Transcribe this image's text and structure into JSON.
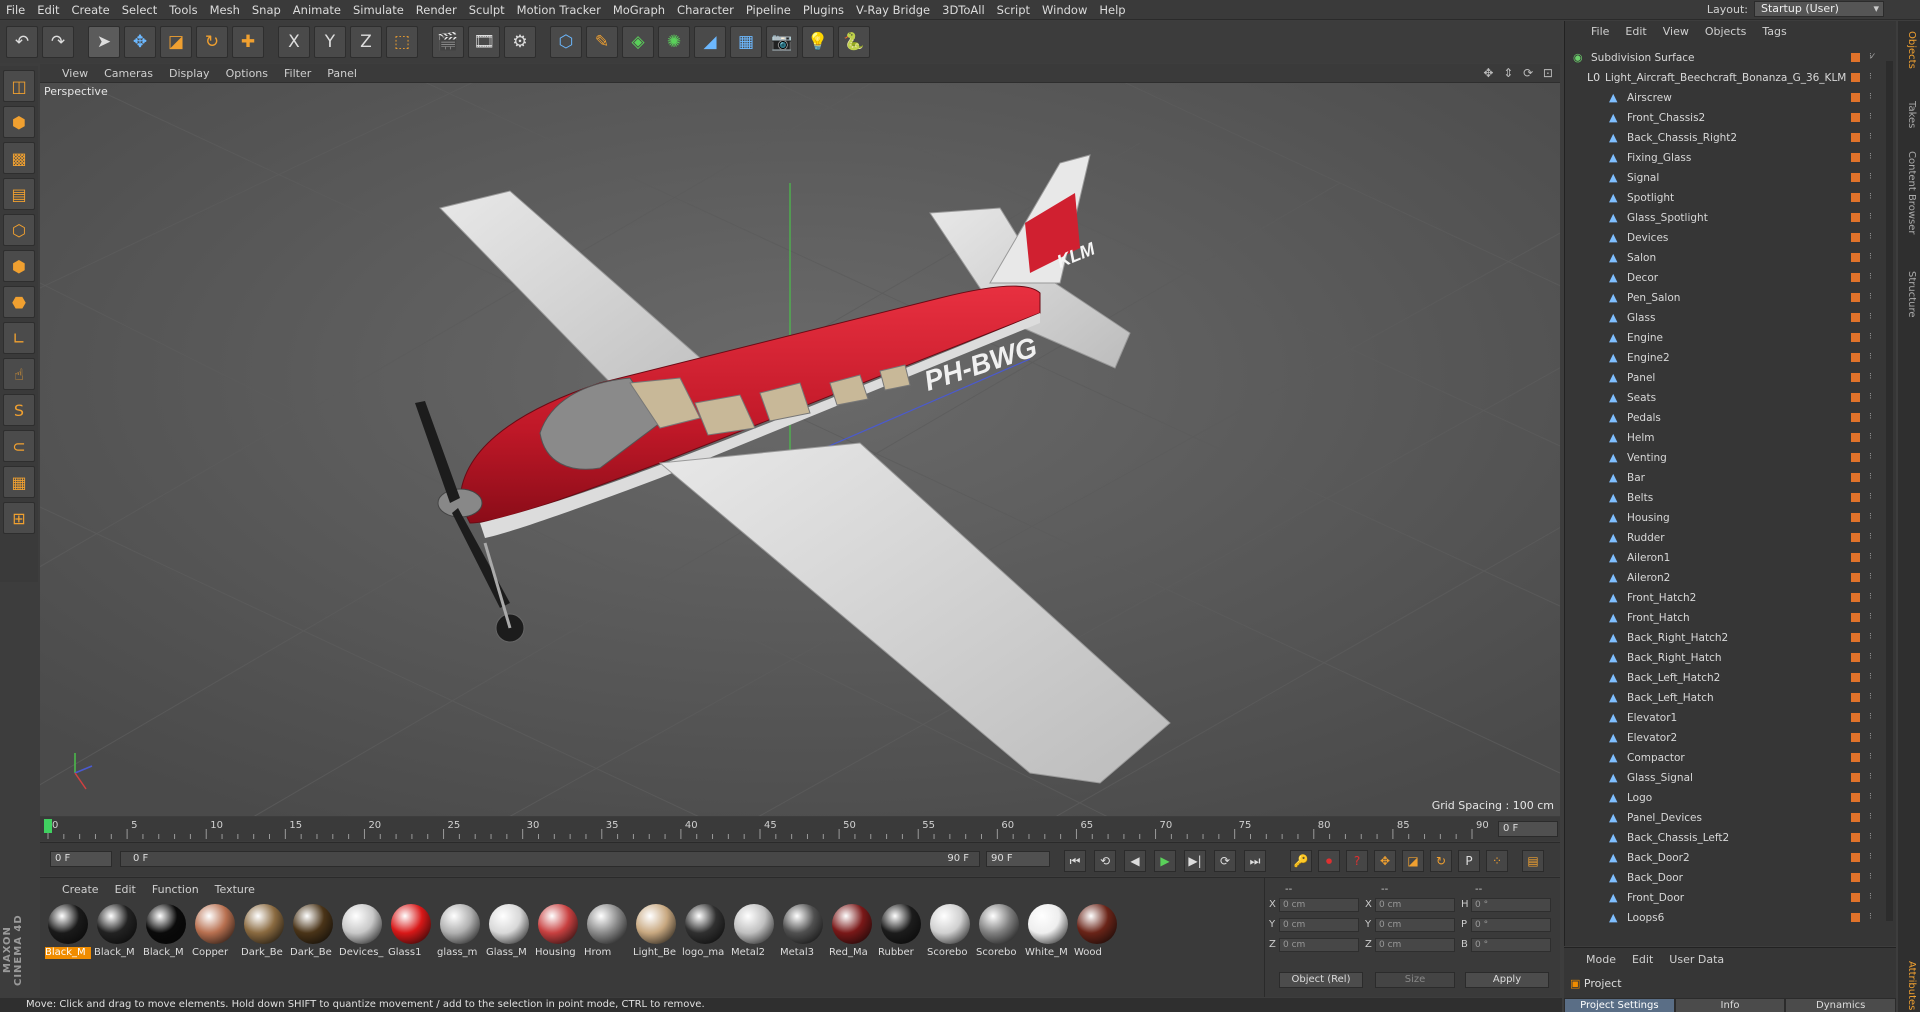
{
  "menubar": {
    "items": [
      "File",
      "Edit",
      "Create",
      "Select",
      "Tools",
      "Mesh",
      "Snap",
      "Animate",
      "Simulate",
      "Render",
      "Sculpt",
      "Motion Tracker",
      "MoGraph",
      "Character",
      "Pipeline",
      "Plugins",
      "V-Ray Bridge",
      "3DToAll",
      "Script",
      "Window",
      "Help"
    ],
    "layout_label": "Layout:",
    "layout_value": "Startup (User)"
  },
  "toolbar": {
    "icons": [
      "undo-icon",
      "redo-icon",
      "select-arrow-icon",
      "move-icon",
      "scale-icon",
      "rotate-icon",
      "move-plus-icon",
      "x-axis-icon",
      "y-axis-icon",
      "z-axis-icon",
      "coordinate-system-icon",
      "render-view-icon",
      "render-picture-viewer-icon",
      "render-settings-icon",
      "cube-icon",
      "pen-icon",
      "subdivision-icon",
      "array-icon",
      "deformer-icon",
      "floor-icon",
      "camera-icon",
      "light-icon",
      "python-icon"
    ],
    "glyphs": [
      "↶",
      "↷",
      "➤",
      "✥",
      "◪",
      "↻",
      "✚",
      "X",
      "Y",
      "Z",
      "⬚",
      "🎬",
      "🎞",
      "⚙",
      "⬡",
      "✎",
      "◈",
      "✺",
      "◢",
      "▦",
      "📷",
      "💡",
      "🐍"
    ]
  },
  "left_tools": {
    "icons": [
      "model-mode-icon",
      "object-mode-icon",
      "texture-mode-icon",
      "workplane-icon",
      "points-mode-icon",
      "edges-mode-icon",
      "polygons-mode-icon",
      "axis-mode-icon",
      "tweak-icon",
      "snap-icon",
      "magnet-icon",
      "grid-icon",
      "lock-grid-icon"
    ],
    "glyphs": [
      "◫",
      "⬢",
      "▩",
      "▤",
      "⬡",
      "⬢",
      "⬣",
      "∟",
      "☝",
      "S",
      "⊂",
      "▦",
      "⊞"
    ]
  },
  "viewport": {
    "menu": [
      "View",
      "Cameras",
      "Display",
      "Options",
      "Filter",
      "Panel"
    ],
    "label": "Perspective",
    "grid_spacing": "Grid Spacing : 100 cm",
    "nav": "✥ ⇕ ⟳ ⊡",
    "registration": "PH-BWG",
    "tail_logo": "KLM"
  },
  "timeline": {
    "ticks": [
      "0",
      "5",
      "10",
      "15",
      "20",
      "25",
      "30",
      "35",
      "40",
      "45",
      "50",
      "55",
      "60",
      "65",
      "70",
      "75",
      "80",
      "85",
      "90"
    ],
    "end_frame_right": "0 F"
  },
  "playback": {
    "current_frame": "0 F",
    "range_start": "0 F",
    "range_end": "90 F",
    "max_frame": "90 F",
    "buttons": [
      "⏮",
      "⟲",
      "◀",
      "▶",
      "▶|",
      "⟳",
      "⏭"
    ],
    "record_buttons": [
      "🔑",
      "⏺",
      "?",
      "✥",
      "◪",
      "↻",
      "P",
      "⁘",
      "▤"
    ]
  },
  "materials": {
    "menu": [
      "Create",
      "Edit",
      "Function",
      "Texture"
    ],
    "items": [
      {
        "name": "Black_M",
        "color": "#1a1a1a",
        "selected": true
      },
      {
        "name": "Black_M",
        "color": "#222222"
      },
      {
        "name": "Black_M",
        "color": "#0a0a0a"
      },
      {
        "name": "Copper",
        "color": "#b87050"
      },
      {
        "name": "Dark_Be",
        "color": "#8a6a40"
      },
      {
        "name": "Dark_Be",
        "color": "#4a3418"
      },
      {
        "name": "Devices_",
        "color": "#c8c8c8"
      },
      {
        "name": "Glass1",
        "color": "#d81818"
      },
      {
        "name": "glass_m",
        "color": "#b0b0b0"
      },
      {
        "name": "Glass_M",
        "color": "#d8d8d8"
      },
      {
        "name": "Housing",
        "color": "#c84040"
      },
      {
        "name": "Hrom",
        "color": "#8a8a8a"
      },
      {
        "name": "Light_Be",
        "color": "#c8a880"
      },
      {
        "name": "logo_ma",
        "color": "#303030"
      },
      {
        "name": "Metal2",
        "color": "#c0c0c0"
      },
      {
        "name": "Metal3",
        "color": "#505050"
      },
      {
        "name": "Red_Ma",
        "color": "#7a1818"
      },
      {
        "name": "Rubber",
        "color": "#1c1c1c"
      },
      {
        "name": "Scorebo",
        "color": "#d0d0d0"
      },
      {
        "name": "Scorebo",
        "color": "#808080"
      },
      {
        "name": "White_M",
        "color": "#eeeeee"
      },
      {
        "name": "Wood",
        "color": "#6a2418"
      }
    ]
  },
  "coords": {
    "header_a": "--",
    "header_b": "--",
    "header_c": "--",
    "rows": [
      {
        "a": "X",
        "av": "0 cm",
        "b": "X",
        "bv": "0 cm",
        "c": "H",
        "cv": "0 °"
      },
      {
        "a": "Y",
        "av": "0 cm",
        "b": "Y",
        "bv": "0 cm",
        "c": "P",
        "cv": "0 °"
      },
      {
        "a": "Z",
        "av": "0 cm",
        "b": "Z",
        "bv": "0 cm",
        "c": "B",
        "cv": "0 °"
      }
    ],
    "mode": "Object (Rel)",
    "size": "Size",
    "apply": "Apply"
  },
  "status": "Move: Click and drag to move elements. Hold down SHIFT to quantize movement / add to the selection in point mode, CTRL to remove.",
  "brand": "MAXON CINEMA 4D",
  "object_manager": {
    "menu": [
      "File",
      "Edit",
      "View",
      "Objects",
      "Tags"
    ],
    "root": "Subdivision Surface",
    "group": "Light_Aircraft_Beechcraft_Bonanza_G_36_KLM",
    "children": [
      "Airscrew",
      "Front_Chassis2",
      "Back_Chassis_Right2",
      "Fixing_Glass",
      "Signal",
      "Spotlight",
      "Glass_Spotlight",
      "Devices",
      "Salon",
      "Decor",
      "Pen_Salon",
      "Glass",
      "Engine",
      "Engine2",
      "Panel",
      "Seats",
      "Pedals",
      "Helm",
      "Venting",
      "Bar",
      "Belts",
      "Housing",
      "Rudder",
      "Aileron1",
      "Aileron2",
      "Front_Hatch2",
      "Front_Hatch",
      "Back_Right_Hatch2",
      "Back_Right_Hatch",
      "Back_Left_Hatch2",
      "Back_Left_Hatch",
      "Elevator1",
      "Elevator2",
      "Compactor",
      "Glass_Signal",
      "Logo",
      "Panel_Devices",
      "Back_Chassis_Left2",
      "Back_Door2",
      "Back_Door",
      "Front_Door",
      "Loops6"
    ]
  },
  "side_tabs": [
    "Objects",
    "Takes",
    "Content Browser",
    "Structure"
  ],
  "attributes": {
    "menu": [
      "Mode",
      "Edit",
      "User Data"
    ],
    "title": "Project",
    "tabs": [
      "Project Settings",
      "Info",
      "Dynamics"
    ],
    "side_tab": "Attributes"
  }
}
